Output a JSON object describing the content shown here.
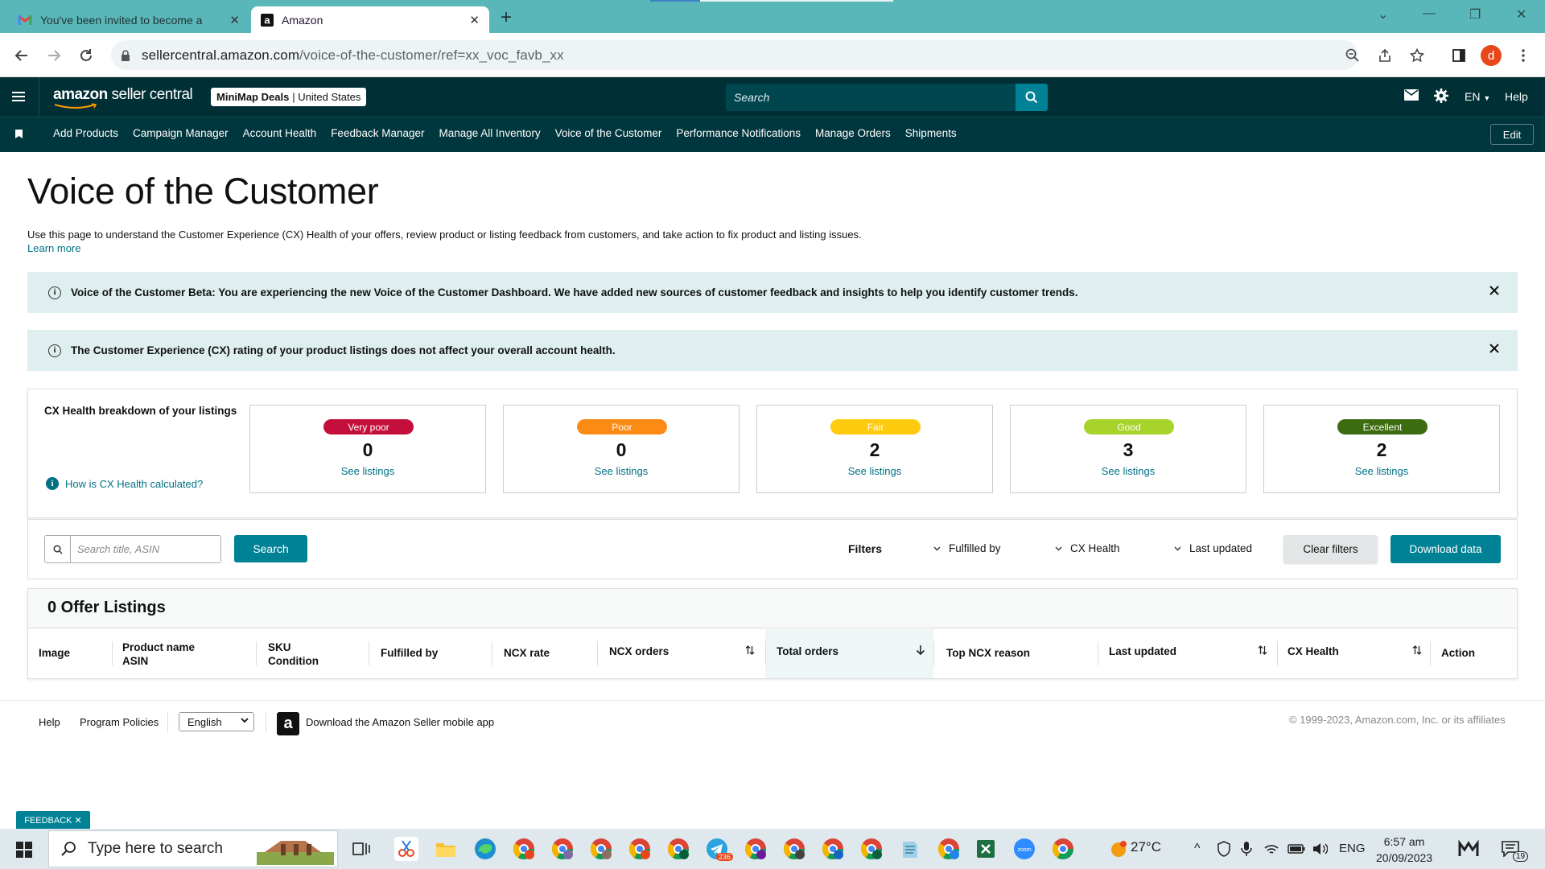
{
  "browser": {
    "tabs": [
      {
        "title": "You've been invited to become a",
        "icon": "gmail-icon"
      },
      {
        "title": "Amazon",
        "icon": "amazon-a-icon"
      }
    ],
    "url_host": "sellercentral.amazon.com",
    "url_path": "/voice-of-the-customer/ref=xx_voc_favb_xx",
    "profile_initial": "d"
  },
  "header": {
    "logo_bold": "amazon",
    "logo_light": " seller central",
    "marketplace_store": "MiniMap Deals",
    "marketplace_region": "| United States",
    "search_placeholder": "Search",
    "language": "EN",
    "help": "Help"
  },
  "nav": {
    "items": [
      "Add Products",
      "Campaign Manager",
      "Account Health",
      "Feedback Manager",
      "Manage All Inventory",
      "Voice of the Customer",
      "Performance Notifications",
      "Manage Orders",
      "Shipments"
    ],
    "edit": "Edit"
  },
  "page": {
    "title": "Voice of the Customer",
    "description": "Use this page to understand the Customer Experience (CX) Health of your offers, review product or listing feedback from customers, and take action to fix product and listing issues.",
    "learn_more": "Learn more"
  },
  "alerts": [
    "Voice of the Customer Beta: You are experiencing the new Voice of the Customer Dashboard. We have added new sources of customer feedback and insights to help you identify customer trends.",
    "The Customer Experience (CX) rating of your product listings does not affect your overall account health."
  ],
  "cx": {
    "title": "CX Health breakdown of your listings",
    "how": "How is CX Health calculated?",
    "cards": [
      {
        "label": "Very poor",
        "count": "0",
        "link": "See listings",
        "color": "#c40f3c",
        "text_color": "#ffffff"
      },
      {
        "label": "Poor",
        "count": "0",
        "link": "See listings",
        "color": "#fb8b14",
        "text_color": "#ffffff"
      },
      {
        "label": "Fair",
        "count": "2",
        "link": "See listings",
        "color": "#ffcb0f",
        "text_color": "#ffffff"
      },
      {
        "label": "Good",
        "count": "3",
        "link": "See listings",
        "color": "#a8d32a",
        "text_color": "#ffffff"
      },
      {
        "label": "Excellent",
        "count": "2",
        "link": "See listings",
        "color": "#3d6b0f",
        "text_color": "#ffffff"
      }
    ]
  },
  "filters": {
    "search_placeholder": "Search title, ASIN",
    "search_button": "Search",
    "label": "Filters",
    "selects": [
      "Fulfilled by",
      "CX Health",
      "Last updated"
    ],
    "clear": "Clear filters",
    "download": "Download data"
  },
  "listings": {
    "title": "0 Offer Listings",
    "columns": [
      {
        "line1": "Image",
        "line2": ""
      },
      {
        "line1": "Product name",
        "line2": "ASIN"
      },
      {
        "line1": "SKU",
        "line2": "Condition"
      },
      {
        "line1": "Fulfilled by",
        "line2": ""
      },
      {
        "line1": "NCX rate",
        "line2": ""
      },
      {
        "line1": "NCX orders",
        "line2": ""
      },
      {
        "line1": "Total orders",
        "line2": ""
      },
      {
        "line1": "Top NCX reason",
        "line2": ""
      },
      {
        "line1": "Last updated",
        "line2": ""
      },
      {
        "line1": "CX Health",
        "line2": ""
      },
      {
        "line1": "Action",
        "line2": ""
      }
    ]
  },
  "footer": {
    "help": "Help",
    "policies": "Program Policies",
    "language": "English",
    "app_link": "Download the Amazon Seller mobile app",
    "copyright": "© 1999-2023, Amazon.com, Inc. or its affiliates",
    "feedback": "FEEDBACK ✕"
  },
  "taskbar": {
    "search_placeholder": "Type here to search",
    "weather": "27°C",
    "lang": "ENG",
    "time": "6:57 am",
    "date": "20/09/2023",
    "notif_count": "19",
    "telegram_badge": "236"
  }
}
